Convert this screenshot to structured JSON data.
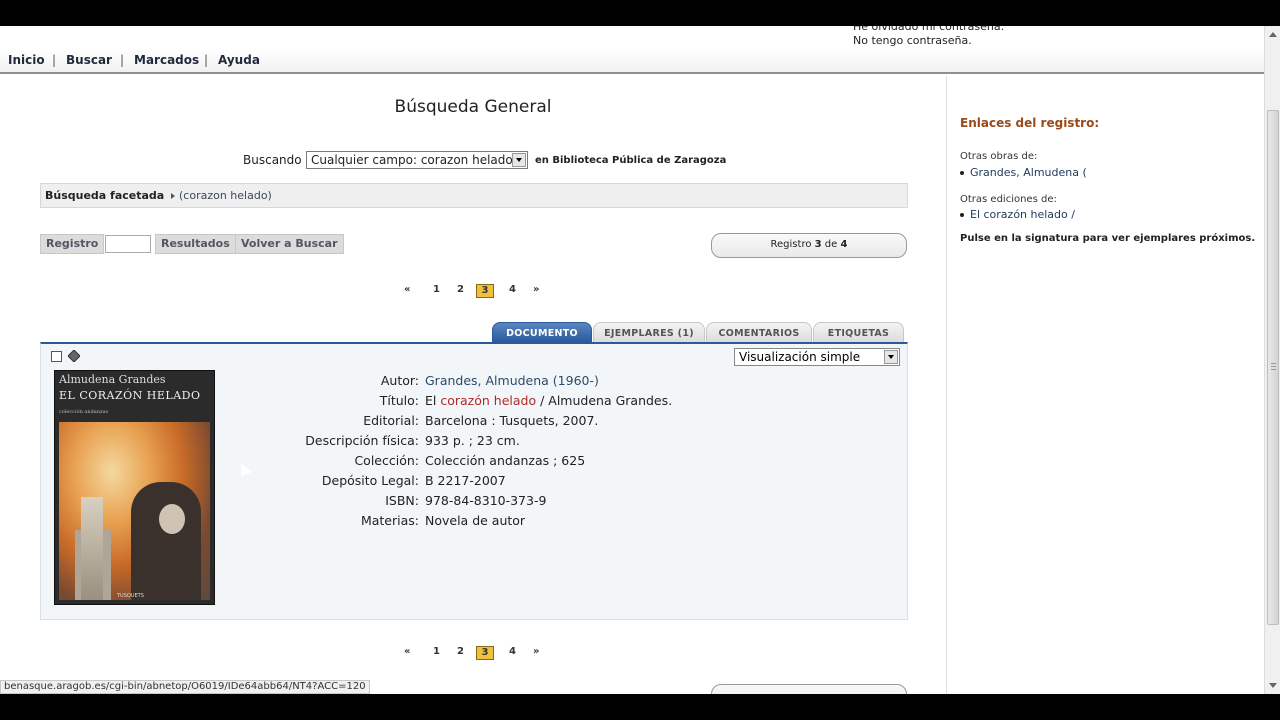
{
  "login": {
    "forgot": "He olvidado mi contraseña.",
    "no_password": "No tengo contraseña."
  },
  "nav": {
    "items": [
      "Inicio",
      "Buscar",
      "Marcados",
      "Ayuda"
    ]
  },
  "page": {
    "title": "Búsqueda General"
  },
  "search": {
    "label": "Buscando",
    "field_value": "Cualquier campo: corazon helado/",
    "where": "en Biblioteca Pública de Zaragoza"
  },
  "facets": {
    "label": "Búsqueda facetada",
    "crumb": "(corazon helado)"
  },
  "toolbar": {
    "registro": "Registro",
    "resultados": "Resultados",
    "volver": "Volver a Buscar"
  },
  "record_count": {
    "prefix": "Registro",
    "current": "3",
    "middle": "de",
    "total": "4"
  },
  "pager": {
    "first": "«",
    "pages": [
      "1",
      "2",
      "3",
      "4"
    ],
    "current": "3",
    "last": "»"
  },
  "tabs": [
    "DOCUMENTO",
    "EJEMPLARES (1)",
    "COMENTARIOS",
    "ETIQUETAS"
  ],
  "view_select": "Visualización simple",
  "cover": {
    "author": "Almudena Grandes",
    "title": "EL CORAZÓN HELADO",
    "collection": "colección andanzas",
    "publisher": "TUSQUETS"
  },
  "record": {
    "fields": [
      {
        "key": "Autor:",
        "value": "Grandes, Almudena (1960-)"
      },
      {
        "key": "Título:",
        "value_pre": "El ",
        "value_hl": "corazón helado",
        "value_post": " / Almudena Grandes."
      },
      {
        "key": "Editorial:",
        "value": "Barcelona : Tusquets, 2007."
      },
      {
        "key": "Descripción física:",
        "value": "933 p. ; 23 cm."
      },
      {
        "key": "Colección:",
        "value": "Colección andanzas ; 625"
      },
      {
        "key": "Depósito Legal:",
        "value": "B 2217-2007"
      },
      {
        "key": "ISBN:",
        "value": "978-84-8310-373-9"
      },
      {
        "key": "Materias:",
        "value": "Novela de autor"
      }
    ]
  },
  "sidebar": {
    "title": "Enlaces del registro:",
    "other_works_label": "Otras obras de:",
    "other_works_link": "Grandes, Almudena (",
    "other_editions_label": "Otras ediciones de:",
    "other_editions_link": "El corazón helado /",
    "note": "Pulse en la signatura para ver ejemplares próximos."
  },
  "status": {
    "url": "benasque.aragob.es/cgi-bin/abnetop/O6019/IDe64abb64/NT4?ACC=120"
  },
  "colors": {
    "tab_active": "#2a5a9c",
    "pager_current": "#f0c040",
    "sidebar_title": "#9a4a1a",
    "highlight": "#b02a2a"
  }
}
